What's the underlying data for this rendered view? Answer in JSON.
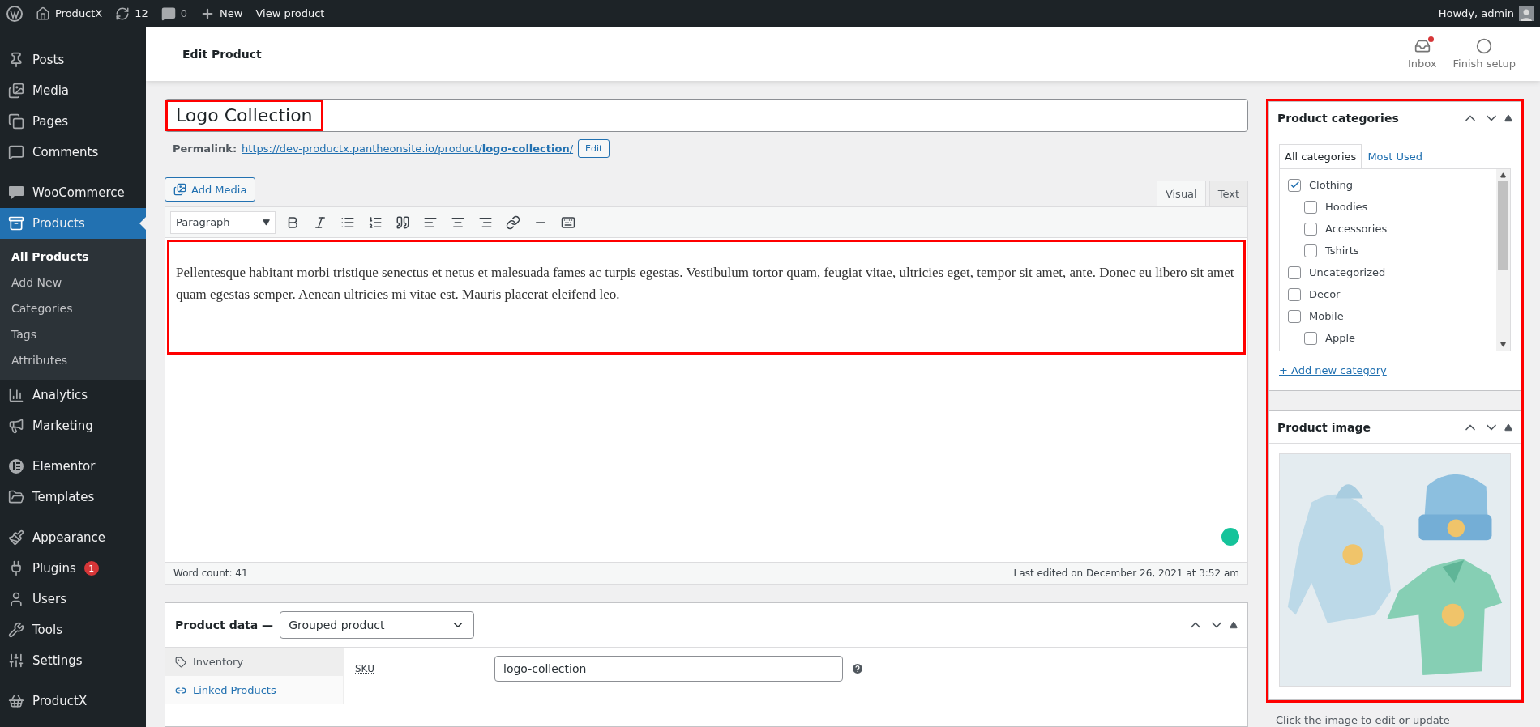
{
  "admin_bar": {
    "site": "ProductX",
    "updates": "12",
    "comments": "0",
    "new": "New",
    "view": "View product",
    "greeting": "Howdy, admin"
  },
  "sidebar": {
    "groups": [
      [
        {
          "label": "Posts",
          "selected": false
        },
        {
          "label": "Media",
          "selected": false
        },
        {
          "label": "Pages",
          "selected": false
        },
        {
          "label": "Comments",
          "selected": false
        }
      ],
      [
        {
          "label": "WooCommerce",
          "selected": false
        },
        {
          "label": "Products",
          "selected": true,
          "children": [
            {
              "label": "All Products",
              "selected": true
            },
            {
              "label": "Add New",
              "selected": false
            },
            {
              "label": "Categories",
              "selected": false
            },
            {
              "label": "Tags",
              "selected": false
            },
            {
              "label": "Attributes",
              "selected": false
            }
          ]
        },
        {
          "label": "Analytics",
          "selected": false
        },
        {
          "label": "Marketing",
          "selected": false
        }
      ],
      [
        {
          "label": "Elementor",
          "selected": false
        },
        {
          "label": "Templates",
          "selected": false
        }
      ],
      [
        {
          "label": "Appearance",
          "selected": false
        },
        {
          "label": "Plugins",
          "selected": false,
          "badge": "1"
        },
        {
          "label": "Users",
          "selected": false
        },
        {
          "label": "Tools",
          "selected": false
        },
        {
          "label": "Settings",
          "selected": false
        }
      ],
      [
        {
          "label": "ProductX",
          "selected": false
        }
      ]
    ]
  },
  "header": {
    "title": "Edit Product",
    "actions": [
      {
        "label": "Inbox",
        "notification": true
      },
      {
        "label": "Finish setup",
        "notification": false
      }
    ]
  },
  "title_field": {
    "value": "Logo Collection",
    "highlighted": true
  },
  "permalink": {
    "label": "Permalink:",
    "url": "https://dev-productx.pantheonsite.io/product/**logo-collection**/",
    "edit": "Edit"
  },
  "editor": {
    "add_media": "Add Media",
    "tabs": [
      {
        "label": "Visual",
        "selected": true
      },
      {
        "label": "Text",
        "selected": false
      }
    ],
    "format": "Paragraph",
    "content": "Pellentesque habitant morbi tristique senectus et netus et malesuada fames ac turpis egestas. Vestibulum tortor quam, feugiat vitae, ultricies eget, tempor sit amet, ante. Donec eu libero sit amet quam egestas semper. Aenean ultricies mi vitae est. Mauris placerat eleifend leo.",
    "highlighted": true,
    "word_count": "Word count: 41",
    "last_edited": "Last edited on December 26, 2021 at 3:52 am"
  },
  "product_data": {
    "title": "Product data —",
    "type": "Grouped product",
    "tabs": [
      {
        "label": "Inventory",
        "selected": true
      },
      {
        "label": "Linked Products",
        "selected": false
      }
    ],
    "fields": [
      {
        "label": "SKU",
        "value": "logo-collection"
      }
    ]
  },
  "side_boxes": {
    "highlighted": true,
    "categories": {
      "title": "Product categories",
      "tabs": [
        {
          "label": "All categories",
          "selected": true
        },
        {
          "label": "Most Used",
          "selected": false
        }
      ],
      "items": [
        {
          "label": "Clothing",
          "checked": true,
          "children": [
            {
              "label": "Hoodies",
              "checked": false
            },
            {
              "label": "Accessories",
              "checked": false
            },
            {
              "label": "Tshirts",
              "checked": false
            }
          ]
        },
        {
          "label": "Uncategorized",
          "checked": false
        },
        {
          "label": "Decor",
          "checked": false
        },
        {
          "label": "Mobile",
          "checked": false,
          "children": [
            {
              "label": "Apple",
              "checked": false
            }
          ]
        }
      ],
      "add_link": "+ Add new category"
    },
    "image": {
      "title": "Product image",
      "kind": "picture",
      "caption": "Click the image to edit or update"
    }
  }
}
